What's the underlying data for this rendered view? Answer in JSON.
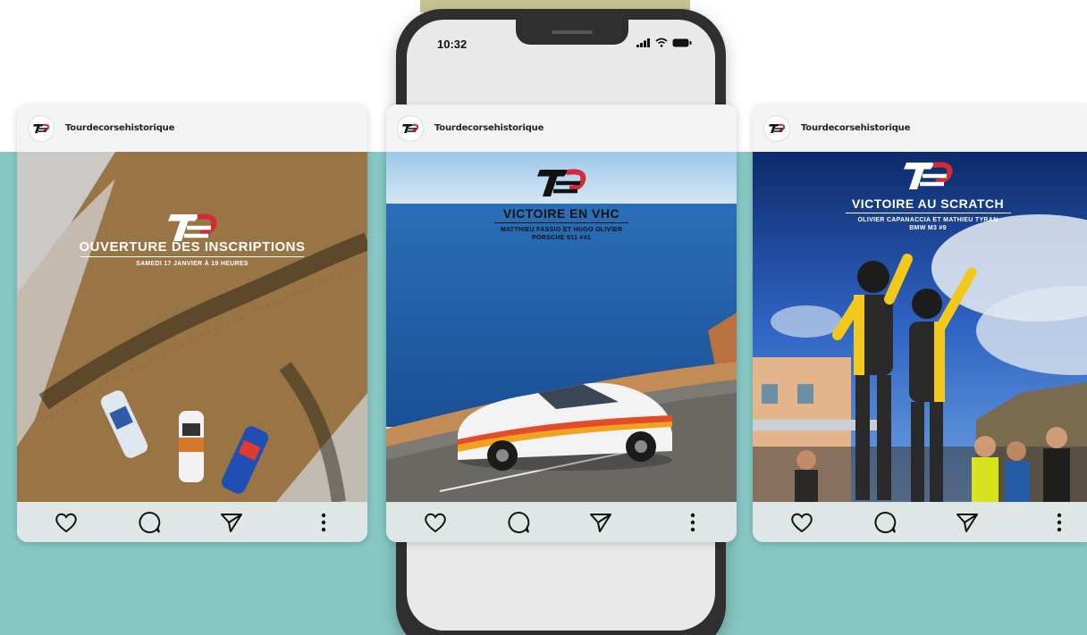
{
  "colors": {
    "teal": "#86c7c4",
    "tab": "#c9c493",
    "logo_red": "#d42a35",
    "logo_black": "#111111"
  },
  "phone": {
    "status_time": "10:32"
  },
  "posts": [
    {
      "username": "Tourdecorsehistorique",
      "title": "OUVERTURE DES INSCRIPTIONS",
      "subtitle_lines": [
        "SAMEDI 17 JANVIER À 19 HEURES"
      ]
    },
    {
      "username": "Tourdecorsehistorique",
      "title": "VICTOIRE EN VHC",
      "subtitle_lines": [
        "MATTHIEU FASSIO ET HUGO OLIVIER",
        "PORSCHE 911 #41"
      ]
    },
    {
      "username": "Tourdecorsehistorique",
      "title": "VICTOIRE AU SCRATCH",
      "subtitle_lines": [
        "OLIVIER CAPANACCIA ET MATHIEU TYRAN",
        "BMW M3 #9"
      ]
    }
  ],
  "icons": [
    "heart-icon",
    "comment-icon",
    "send-icon",
    "more-icon"
  ]
}
